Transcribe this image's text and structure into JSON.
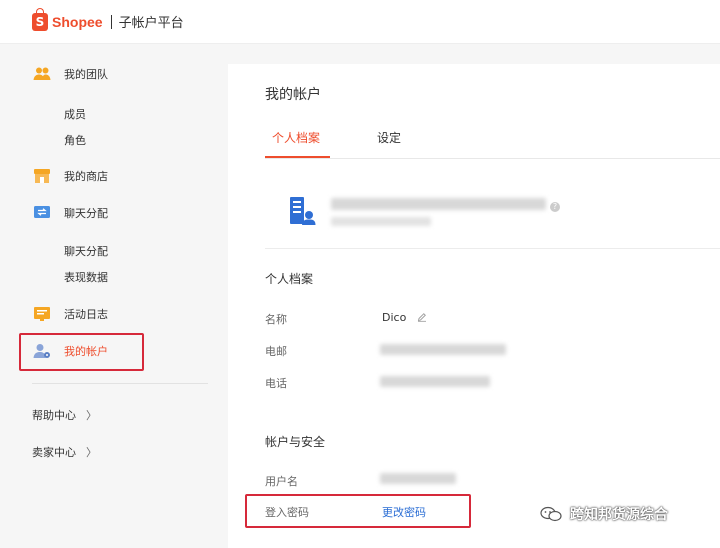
{
  "header": {
    "brand": "Shopee",
    "logo_letter": "S",
    "platform": "子帐户平台"
  },
  "sidebar": {
    "team": {
      "label": "我的团队",
      "children": [
        "成员",
        "角色"
      ]
    },
    "store": {
      "label": "我的商店"
    },
    "chat": {
      "label": "聊天分配",
      "children": [
        "聊天分配",
        "表现数据"
      ]
    },
    "log": {
      "label": "活动日志"
    },
    "account": {
      "label": "我的帐户"
    },
    "help": {
      "label": "帮助中心"
    },
    "seller": {
      "label": "卖家中心"
    }
  },
  "main": {
    "title": "我的帐户",
    "tabs": [
      {
        "label": "个人档案"
      },
      {
        "label": "设定"
      }
    ],
    "profile": {
      "section_title": "个人档案",
      "name_label": "名称",
      "name_value": "Dico",
      "email_label": "电邮",
      "phone_label": "电话"
    },
    "security": {
      "section_title": "帐户与安全",
      "username_label": "用户名",
      "password_label": "登入密码",
      "change_password": "更改密码"
    }
  },
  "watermark": {
    "text": "跨知邦货源综合"
  },
  "colors": {
    "accent": "#ee4d2d",
    "link": "#2a6dd4",
    "highlight_box": "#d6293a"
  }
}
